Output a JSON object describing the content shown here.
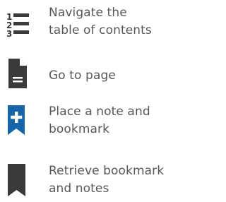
{
  "legend": {
    "items": [
      {
        "icon": "numbered-list-icon",
        "label": "Navigate the\ntable of contents"
      },
      {
        "icon": "page-icon",
        "label": "Go to page"
      },
      {
        "icon": "add-bookmark-icon",
        "label": "Place a note and\nbookmark"
      },
      {
        "icon": "bookmark-icon",
        "label": "Retrieve bookmark\nand notes"
      }
    ],
    "colors": {
      "icon_dark": "#3a3a3a",
      "accent_blue": "#1565a8",
      "text": "#575757"
    }
  }
}
